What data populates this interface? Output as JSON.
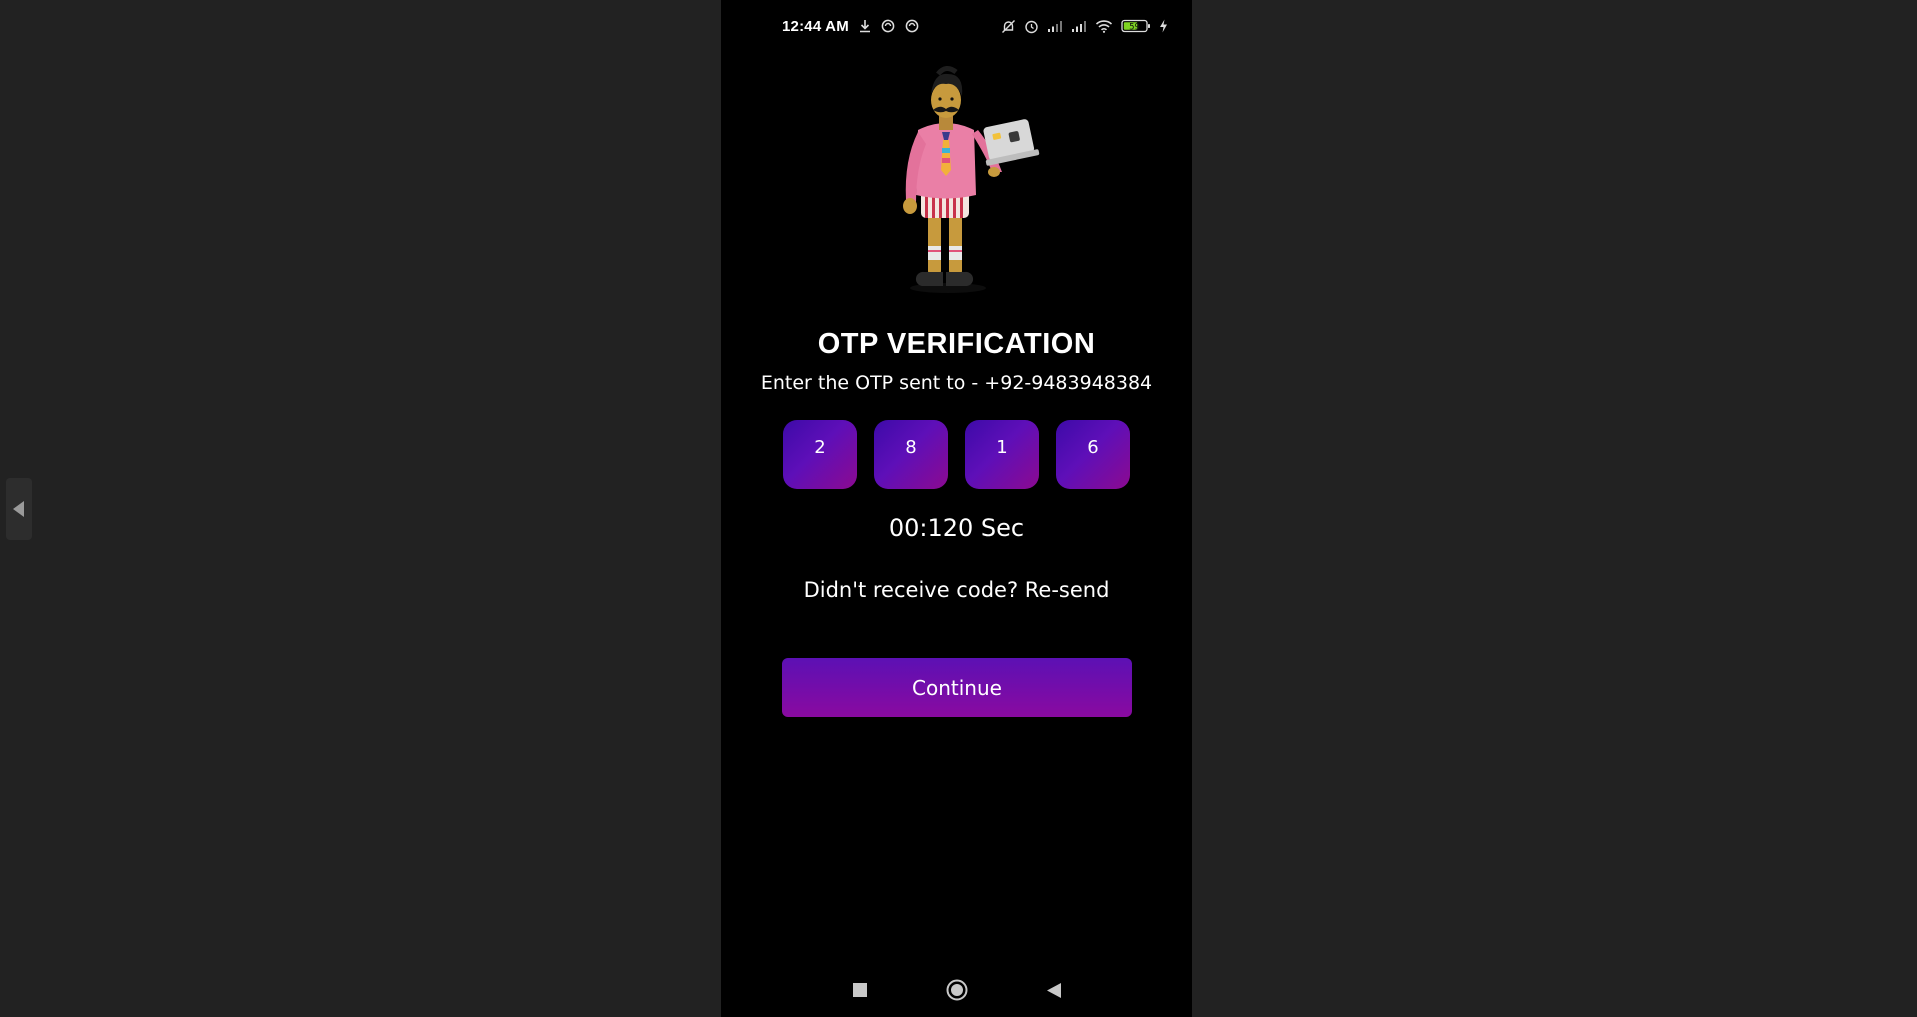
{
  "status_bar": {
    "time": "12:44 AM",
    "battery_level": "59",
    "left_icons": [
      "download-icon",
      "sync-icon",
      "sync-icon"
    ],
    "right_icons": [
      "notifications-off-icon",
      "alarm-icon",
      "signal-icon",
      "signal-icon",
      "wifi-icon",
      "battery-icon",
      "charging-icon"
    ]
  },
  "hero": {
    "image": "character-with-laptop-illustration"
  },
  "otp": {
    "title": "OTP VERIFICATION",
    "subtitle": "Enter the OTP sent to - +92-9483948384",
    "digits": [
      "2",
      "8",
      "1",
      "6"
    ],
    "timer": "00:120 Sec",
    "resend_prompt": "Didn't receive code? Re-send",
    "continue_label": "Continue"
  },
  "navigation": {
    "buttons": [
      "recents-square-icon",
      "home-circle-icon",
      "back-triangle-icon"
    ]
  },
  "colors": {
    "background": "#222222",
    "screen": "#000000",
    "accent_start": "#5c10b4",
    "accent_end": "#8a0aa0"
  }
}
